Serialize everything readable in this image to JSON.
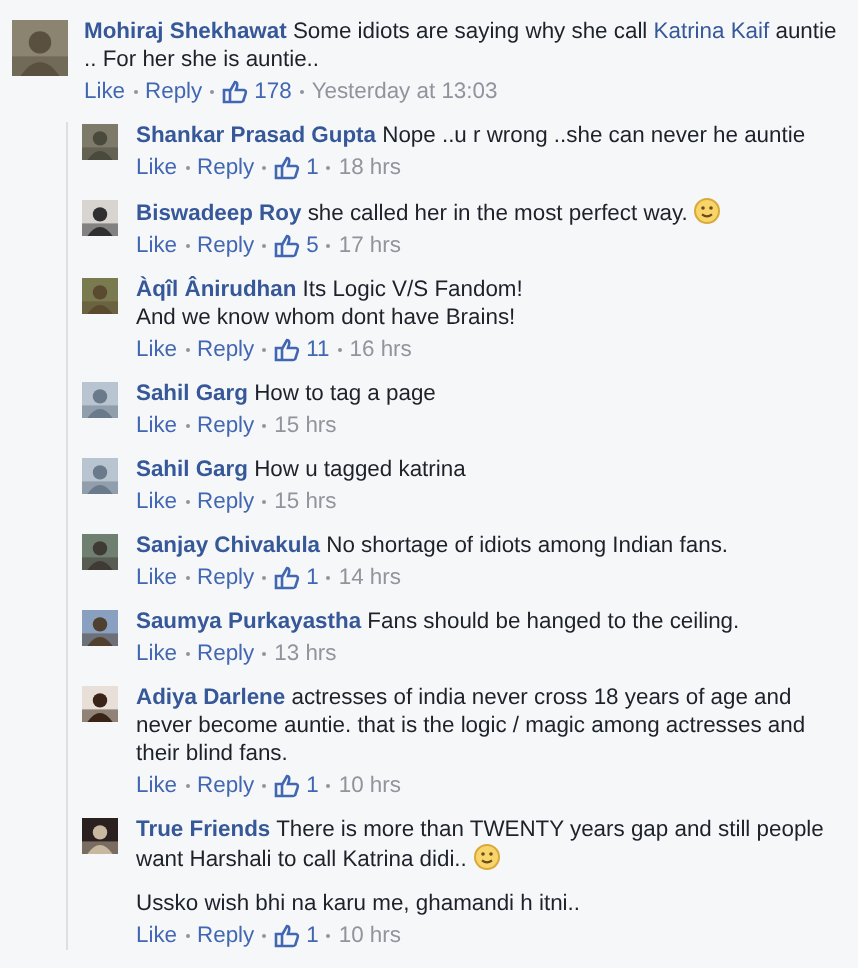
{
  "comment": {
    "author": "Mohiraj Shekhawat",
    "paragraphs": [
      [
        {
          "kind": "text",
          "text": "Some idiots are saying why she call "
        },
        {
          "kind": "link",
          "text": "Katrina Kaif"
        },
        {
          "kind": "text",
          "text": " auntie .. For her she is auntie.."
        }
      ]
    ],
    "actions": [
      "Like",
      "Reply"
    ],
    "likes": "178",
    "time": "Yesterday at 13:03"
  },
  "replies": [
    {
      "author": "Shankar Prasad Gupta",
      "paragraphs": [
        [
          {
            "kind": "text",
            "text": "Nope ..u r wrong ..she can never he auntie"
          }
        ]
      ],
      "actions": [
        "Like",
        "Reply"
      ],
      "likes": "1",
      "time": "18 hrs"
    },
    {
      "author": "Biswadeep Roy",
      "paragraphs": [
        [
          {
            "kind": "text",
            "text": "she called her in the most perfect way. "
          },
          {
            "kind": "emoji"
          }
        ]
      ],
      "actions": [
        "Like",
        "Reply"
      ],
      "likes": "5",
      "time": "17 hrs"
    },
    {
      "author": "Àqîl Ânirudhan",
      "paragraphs": [
        [
          {
            "kind": "text",
            "text": "Its Logic V/S Fandom!\nAnd we know whom dont have Brains!"
          }
        ]
      ],
      "actions": [
        "Like",
        "Reply"
      ],
      "likes": "11",
      "time": "16 hrs"
    },
    {
      "author": "Sahil Garg",
      "paragraphs": [
        [
          {
            "kind": "text",
            "text": "How to tag a page"
          }
        ]
      ],
      "actions": [
        "Like",
        "Reply"
      ],
      "time": "15 hrs"
    },
    {
      "author": "Sahil Garg",
      "paragraphs": [
        [
          {
            "kind": "text",
            "text": "How u tagged katrina"
          }
        ]
      ],
      "actions": [
        "Like",
        "Reply"
      ],
      "time": "15 hrs"
    },
    {
      "author": "Sanjay Chivakula",
      "paragraphs": [
        [
          {
            "kind": "text",
            "text": "No shortage of idiots among Indian fans."
          }
        ]
      ],
      "actions": [
        "Like",
        "Reply"
      ],
      "likes": "1",
      "time": "14 hrs"
    },
    {
      "author": "Saumya Purkayastha",
      "paragraphs": [
        [
          {
            "kind": "text",
            "text": "Fans should be hanged to the ceiling."
          }
        ]
      ],
      "actions": [
        "Like",
        "Reply"
      ],
      "time": "13 hrs"
    },
    {
      "author": "Adiya Darlene",
      "paragraphs": [
        [
          {
            "kind": "text",
            "text": "actresses of india never cross 18 years of age and never become auntie. that is the logic / magic among actresses and their blind fans."
          }
        ]
      ],
      "actions": [
        "Like",
        "Reply"
      ],
      "likes": "1",
      "time": "10 hrs"
    },
    {
      "author": "True Friends",
      "paragraphs": [
        [
          {
            "kind": "text",
            "text": "There is more than TWENTY years gap and still people want Harshali to call Katrina didi.. "
          },
          {
            "kind": "emoji"
          }
        ],
        [
          {
            "kind": "text",
            "text": "Ussko wish bhi na karu me, ghamandi h itni.."
          }
        ]
      ],
      "actions": [
        "Like",
        "Reply"
      ],
      "likes": "1",
      "time": "10 hrs"
    }
  ]
}
